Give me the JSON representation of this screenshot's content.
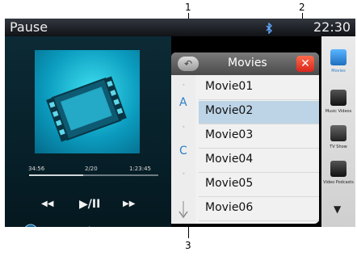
{
  "callouts": [
    "1",
    "2",
    "3"
  ],
  "status": {
    "title": "Pause",
    "bluetooth_icon": "bluetooth-icon",
    "time": "22:30"
  },
  "player": {
    "elapsed": "34:56",
    "track": "2/20",
    "duration": "1:23:45",
    "progress": 0.42,
    "prev_label": "◀◀",
    "playpause_label": "▶/II",
    "next_label": "▶▶",
    "repeat_icon": "repeat-icon",
    "next_page_icon": "arrow-right-circle-icon"
  },
  "list": {
    "title": "Movies",
    "back_label": "↶",
    "close_label": "✕",
    "index_letters": [
      "A",
      "C"
    ],
    "items": [
      "Movie01",
      "Movie02",
      "Movie03",
      "Movie04",
      "Movie05",
      "Movie06"
    ],
    "selected_index": 1
  },
  "sidebar": {
    "items": [
      {
        "label": "Movies",
        "color": "#2f8fd8",
        "active": true
      },
      {
        "label": "Music Videos",
        "color": "#2a2a2a"
      },
      {
        "label": "TV Show",
        "color": "#3a3a3a"
      },
      {
        "label": "Video Podcasts",
        "color": "#2a2a2a"
      }
    ],
    "scroll_down_label": "▼"
  },
  "colors": {
    "accent": "#2d7ec8",
    "close_red": "#e03a24",
    "selected_row": "#bdd4e6"
  }
}
